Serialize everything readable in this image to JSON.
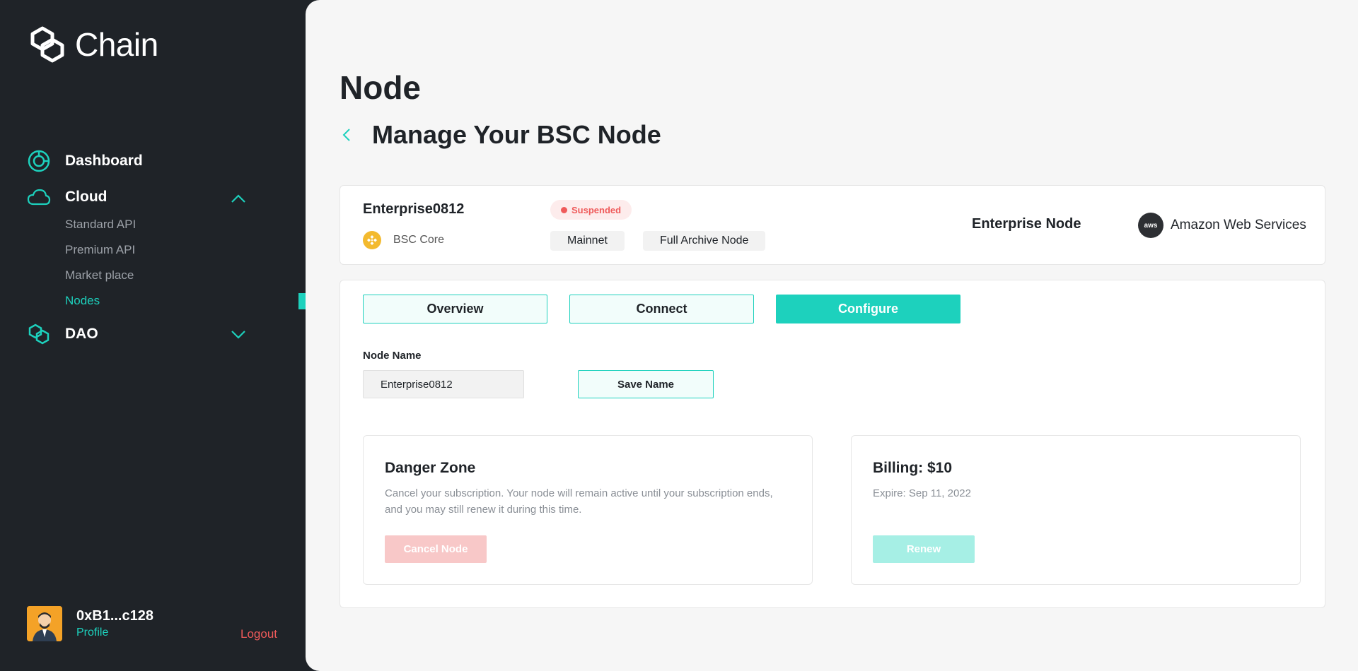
{
  "brand": {
    "name": "Chain"
  },
  "sidebar": {
    "items": [
      {
        "label": "Dashboard",
        "icon": "dashboard-icon"
      },
      {
        "label": "Cloud",
        "icon": "cloud-icon",
        "expanded": true,
        "children": [
          "Standard API",
          "Premium API",
          "Market place",
          "Nodes"
        ]
      },
      {
        "label": "DAO",
        "icon": "dao-icon",
        "expanded": false
      }
    ],
    "active_child": "Nodes"
  },
  "user": {
    "wallet": "0xB1...c128",
    "profile_label": "Profile",
    "logout_label": "Logout"
  },
  "page": {
    "title": "Node",
    "subtitle": "Manage Your BSC Node"
  },
  "node": {
    "name": "Enterprise0812",
    "status": "Suspended",
    "chain": "BSC Core",
    "network": "Mainnet",
    "node_kind": "Full Archive Node",
    "type": "Enterprise Node",
    "provider": "Amazon Web Services",
    "provider_logo_text": "aws"
  },
  "tabs": [
    {
      "label": "Overview",
      "active": false
    },
    {
      "label": "Connect",
      "active": false
    },
    {
      "label": "Configure",
      "active": true
    }
  ],
  "configure": {
    "node_name_label": "Node Name",
    "node_name_value": "Enterprise0812",
    "save_label": "Save Name",
    "danger": {
      "title": "Danger Zone",
      "description": "Cancel your subscription. Your node will remain active until your subscription ends, and you may still renew it during this time.",
      "button": "Cancel Node"
    },
    "billing": {
      "title": "Billing: $10",
      "expire": "Expire: Sep 11, 2022",
      "button": "Renew"
    }
  },
  "colors": {
    "accent": "#1dd1bd",
    "danger": "#ef5a5a",
    "sidebar_bg": "#1f2328",
    "main_bg": "#f6f6f6"
  }
}
